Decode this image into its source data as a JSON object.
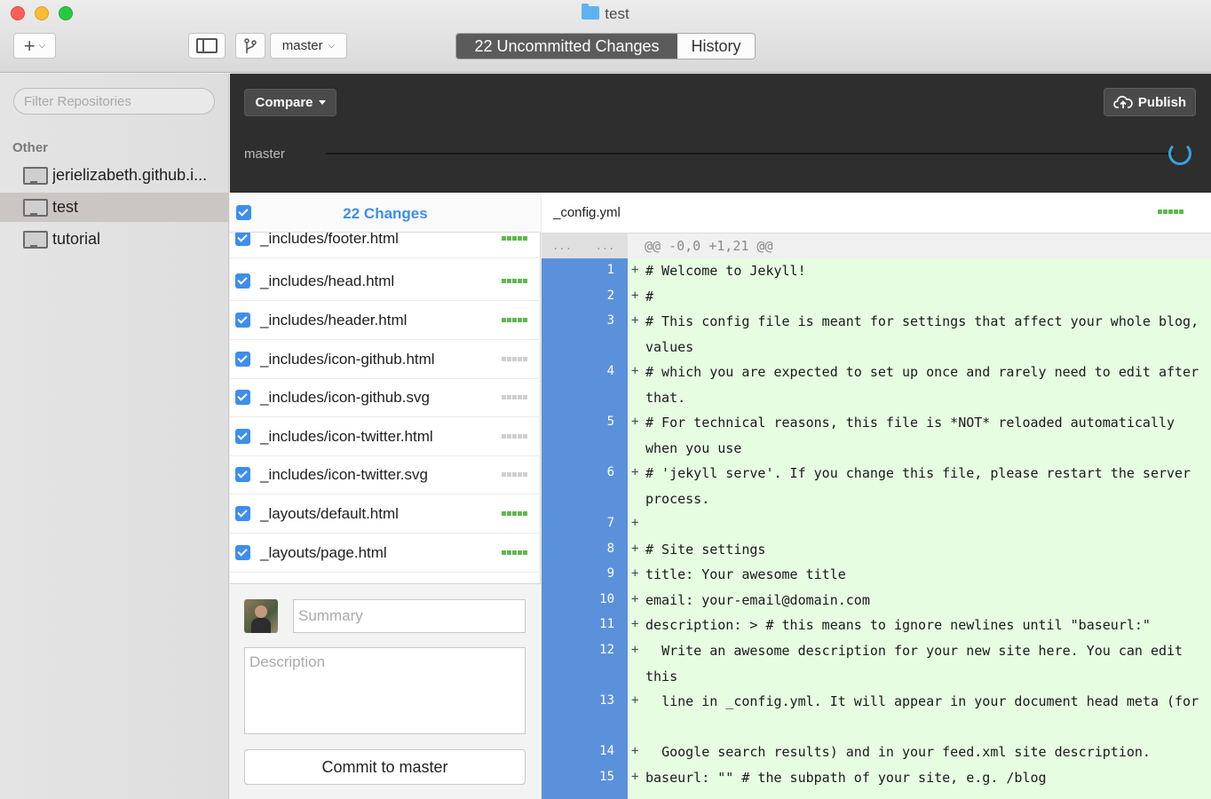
{
  "window": {
    "title": "test"
  },
  "toolbar": {
    "add_label": "+",
    "branch_label": "master",
    "tabs": [
      {
        "label": "22 Uncommitted Changes",
        "active": true
      },
      {
        "label": "History",
        "active": false
      }
    ]
  },
  "sidebar": {
    "filter_placeholder": "Filter Repositories",
    "section_label": "Other",
    "repos": [
      {
        "name": "jerielizabeth.github.i...",
        "selected": false
      },
      {
        "name": "test",
        "selected": true
      },
      {
        "name": "tutorial",
        "selected": false
      }
    ]
  },
  "compare": {
    "compare_label": "Compare",
    "publish_label": "Publish",
    "branch": "master"
  },
  "changes": {
    "title": "22 Changes",
    "files": [
      {
        "name": "_includes/footer.html",
        "bar": "full"
      },
      {
        "name": "_includes/head.html",
        "bar": "full"
      },
      {
        "name": "_includes/header.html",
        "bar": "full"
      },
      {
        "name": "_includes/icon-github.html",
        "bar": "empty"
      },
      {
        "name": "_includes/icon-github.svg",
        "bar": "empty"
      },
      {
        "name": "_includes/icon-twitter.html",
        "bar": "empty"
      },
      {
        "name": "_includes/icon-twitter.svg",
        "bar": "empty"
      },
      {
        "name": "_layouts/default.html",
        "bar": "full"
      },
      {
        "name": "_layouts/page.html",
        "bar": "full"
      }
    ]
  },
  "commit": {
    "summary_placeholder": "Summary",
    "description_placeholder": "Description",
    "commit_label": "Commit to master"
  },
  "diff": {
    "file": "_config.yml",
    "hunk_old": "...",
    "hunk_new": "...",
    "hunk": "@@ -0,0 +1,21 @@",
    "lines": [
      {
        "n": "1",
        "text": "# Welcome to Jekyll!"
      },
      {
        "n": "2",
        "text": "#"
      },
      {
        "n": "3",
        "text": "# This config file is meant for settings that affect your whole blog, values"
      },
      {
        "n": "4",
        "text": "# which you are expected to set up once and rarely need to edit after that."
      },
      {
        "n": "5",
        "text": "# For technical reasons, this file is *NOT* reloaded automatically when you use"
      },
      {
        "n": "6",
        "text": "# 'jekyll serve'. If you change this file, please restart the server process."
      },
      {
        "n": "7",
        "text": ""
      },
      {
        "n": "8",
        "text": "# Site settings"
      },
      {
        "n": "9",
        "text": "title: Your awesome title"
      },
      {
        "n": "10",
        "text": "email: your-email@domain.com"
      },
      {
        "n": "11",
        "text": "description: > # this means to ignore newlines until \"baseurl:\""
      },
      {
        "n": "12",
        "text": "  Write an awesome description for your new site here. You can edit this"
      },
      {
        "n": "13",
        "text": "  line in _config.yml. It will appear in your document head meta (for"
      },
      {
        "n": "14",
        "text": "  Google search results) and in your feed.xml site description."
      },
      {
        "n": "15",
        "text": "baseurl: \"\" # the subpath of your site, e.g. /blog"
      }
    ]
  }
}
